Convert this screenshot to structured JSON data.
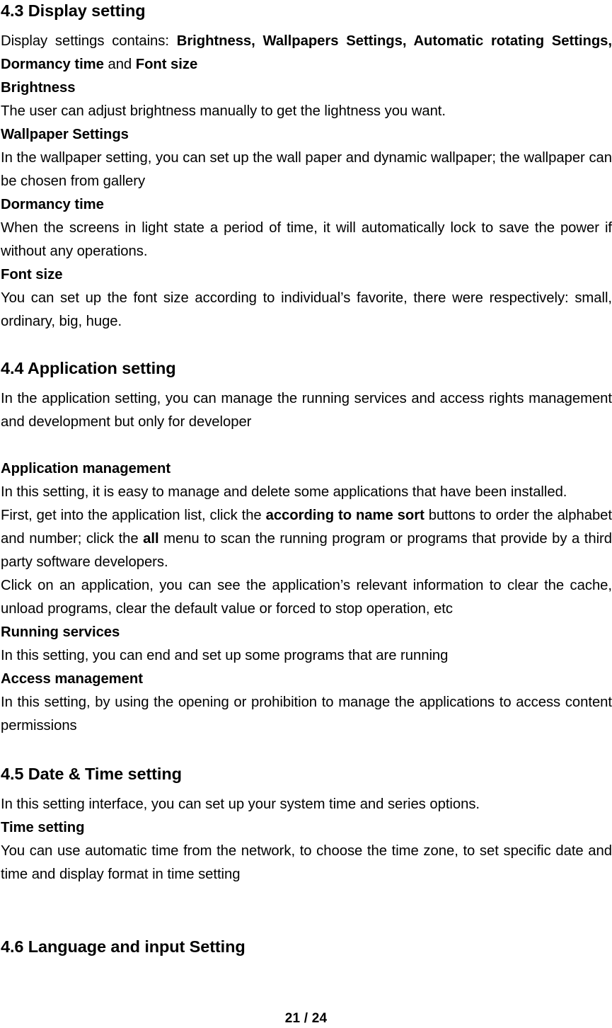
{
  "document": {
    "page_number_label": "21 / 24",
    "sections": [
      {
        "heading": "4.3 Display setting",
        "blocks": [
          {
            "type": "paragraph",
            "runs": [
              {
                "text": "Display settings contains: ",
                "bold": false
              },
              {
                "text": "Brightness, Wallpapers Settings, Automatic rotating Settings, Dormancy time",
                "bold": true
              },
              {
                "text": " and ",
                "bold": false
              },
              {
                "text": "Font size",
                "bold": true
              }
            ]
          },
          {
            "type": "subheading",
            "text": "Brightness"
          },
          {
            "type": "paragraph",
            "runs": [
              {
                "text": "The user can adjust brightness manually to get the lightness you want.",
                "bold": false
              }
            ]
          },
          {
            "type": "subheading",
            "text": "Wallpaper Settings"
          },
          {
            "type": "paragraph",
            "runs": [
              {
                "text": "In the wallpaper setting, you can set up the wall paper and dynamic wallpaper; the wallpaper can be chosen from gallery",
                "bold": false
              }
            ]
          },
          {
            "type": "subheading",
            "text": "Dormancy time"
          },
          {
            "type": "paragraph",
            "runs": [
              {
                "text": "When the screens in light state a period of time, it will automatically lock to save the power if without any operations.",
                "bold": false
              }
            ]
          },
          {
            "type": "subheading",
            "text": "Font size"
          },
          {
            "type": "paragraph",
            "runs": [
              {
                "text": "You can set up the font size according to individual’s favorite, there were respectively: small, ordinary, big, huge.",
                "bold": false
              }
            ]
          }
        ]
      },
      {
        "heading": "4.4 Application setting",
        "blocks": [
          {
            "type": "paragraph",
            "runs": [
              {
                "text": "In the application setting, you can manage the running services and access rights management and development but only for developer",
                "bold": false
              }
            ]
          },
          {
            "type": "subheading",
            "text": "Application management"
          },
          {
            "type": "paragraph",
            "runs": [
              {
                "text": "In this setting, it is easy to manage and delete some applications that have been installed.",
                "bold": false
              }
            ]
          },
          {
            "type": "paragraph",
            "runs": [
              {
                "text": "First, get into the application list, click the ",
                "bold": false
              },
              {
                "text": "according to name sort",
                "bold": true
              },
              {
                "text": " buttons to order the alphabet and number; click the ",
                "bold": false
              },
              {
                "text": "all",
                "bold": true
              },
              {
                "text": " menu to scan the running program or programs that provide by a third party software developers.",
                "bold": false
              }
            ]
          },
          {
            "type": "paragraph",
            "runs": [
              {
                "text": "Click on an application, you can see the application’s relevant information to clear the cache, unload programs, clear the default value or forced to stop operation, etc",
                "bold": false
              }
            ]
          },
          {
            "type": "subheading",
            "text": "Running services"
          },
          {
            "type": "paragraph",
            "runs": [
              {
                "text": "In this setting, you can end and set up some programs that are running",
                "bold": false
              }
            ]
          },
          {
            "type": "subheading",
            "text": "Access management"
          },
          {
            "type": "paragraph",
            "runs": [
              {
                "text": "In this setting, by using the opening or prohibition to manage the applications to access content permissions",
                "bold": false
              }
            ]
          }
        ]
      },
      {
        "heading": "4.5 Date & Time setting",
        "blocks": [
          {
            "type": "paragraph",
            "runs": [
              {
                "text": "In this setting interface, you can set up your system time and series options.",
                "bold": false
              }
            ]
          },
          {
            "type": "subheading",
            "text": "Time setting"
          },
          {
            "type": "paragraph",
            "runs": [
              {
                "text": "You can use automatic time from the network, to choose the time zone, to set specific date and time and display format in time setting",
                "bold": false
              }
            ]
          }
        ]
      },
      {
        "heading": "4.6 Language and input Setting",
        "blocks": []
      }
    ]
  }
}
